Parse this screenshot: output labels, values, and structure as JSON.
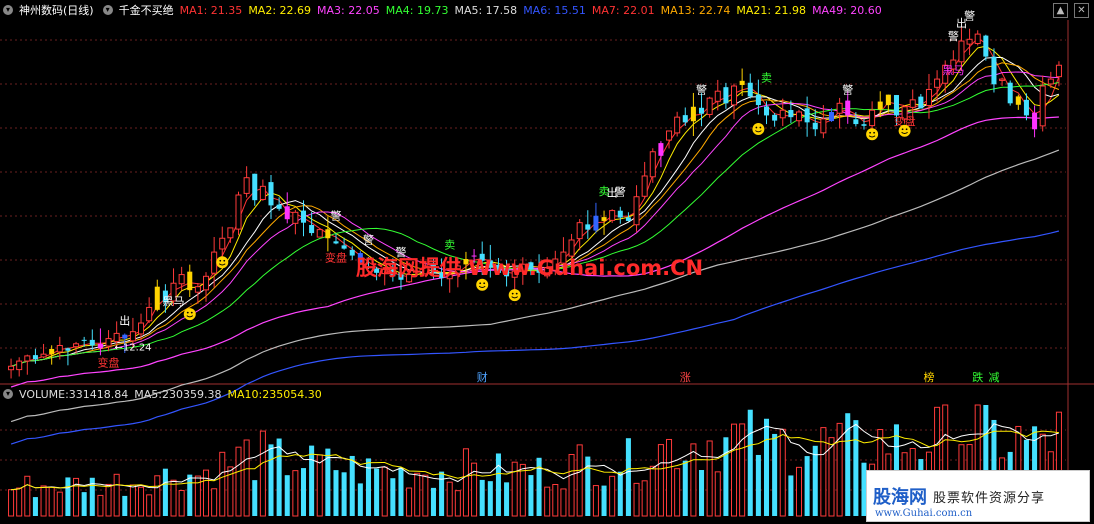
{
  "header": {
    "title": "神州数码(日线)",
    "indicator": "千金不买绝",
    "ma": [
      {
        "label": "MA1:",
        "value": "21.35",
        "color": "#ff3333"
      },
      {
        "label": "MA2:",
        "value": "22.69",
        "color": "#ffee00"
      },
      {
        "label": "MA3:",
        "value": "22.05",
        "color": "#ff44ff"
      },
      {
        "label": "MA4:",
        "value": "19.73",
        "color": "#33ff33"
      },
      {
        "label": "MA5:",
        "value": "17.58",
        "color": "#dddddd"
      },
      {
        "label": "MA6:",
        "value": "15.51",
        "color": "#3355ff"
      },
      {
        "label": "MA7:",
        "value": "22.01",
        "color": "#ff3333"
      },
      {
        "label": "MA13:",
        "value": "22.74",
        "color": "#ffaa00"
      },
      {
        "label": "MA21:",
        "value": "21.98",
        "color": "#ffee00"
      },
      {
        "label": "MA49:",
        "value": "20.60",
        "color": "#ff44ff"
      }
    ]
  },
  "volume_header": {
    "label": "VOLUME:",
    "value": "331418.84",
    "ma5_label": "MA5:",
    "ma5_value": "230359.38",
    "ma10_label": "MA10:",
    "ma10_value": "235054.30"
  },
  "window_buttons": {
    "up": "▲",
    "close": "✕"
  },
  "overlay": "股海网提供 Www.Guhai.com.CN",
  "logo": {
    "brand": "股海网",
    "slogan": "股票软件资源分享",
    "url": "www.Guhai.com.cn"
  },
  "colors": {
    "up": "#ff3a3a",
    "down": "#45e0ff",
    "signal_yellow": "#ffd400",
    "signal_magenta": "#ff33ff",
    "signal_blue": "#3366ff"
  },
  "chart_data": {
    "type": "candlestick",
    "price_range": [
      10.5,
      30.5
    ],
    "closes": [
      10.6,
      10.9,
      11.2,
      11.0,
      11.3,
      11.6,
      11.8,
      11.5,
      11.9,
      12.1,
      11.8,
      11.9,
      12.2,
      12.5,
      12.2,
      12.6,
      13.1,
      14.0,
      15.2,
      14.3,
      15.4,
      15.9,
      15.0,
      15.2,
      15.8,
      17.2,
      18.0,
      18.6,
      20.5,
      21.5,
      20.2,
      21.0,
      19.9,
      19.7,
      19.1,
      19.5,
      18.9,
      18.3,
      18.5,
      18.0,
      17.7,
      17.4,
      17.0,
      16.6,
      16.3,
      16.0,
      16.2,
      15.8,
      15.6,
      15.9,
      16.1,
      16.4,
      16.0,
      15.7,
      15.9,
      16.4,
      16.8,
      17.0,
      16.7,
      16.3,
      16.0,
      15.8,
      16.1,
      16.5,
      16.2,
      16.0,
      16.3,
      16.8,
      17.2,
      17.9,
      18.9,
      18.5,
      19.3,
      19.0,
      19.6,
      19.2,
      19.0,
      20.4,
      21.6,
      23.0,
      23.5,
      24.2,
      25.0,
      24.7,
      25.6,
      25.2,
      26.1,
      26.5,
      25.8,
      26.8,
      27.1,
      26.2,
      25.7,
      25.1,
      24.8,
      25.4,
      25.0,
      25.3,
      24.7,
      24.3,
      24.9,
      25.3,
      25.8,
      25.1,
      24.6,
      24.5,
      25.4,
      25.9,
      26.3,
      25.1,
      25.6,
      26.0,
      25.5,
      26.6,
      27.2,
      28.0,
      28.3,
      29.4,
      29.5,
      29.8,
      28.5,
      26.9,
      27.2,
      25.8,
      26.2,
      25.1,
      24.3,
      26.8,
      27.2,
      28.0
    ],
    "signals": [
      "警",
      "出",
      "卖",
      "黑马",
      "变盘",
      "财",
      "涨",
      "榜",
      "跌",
      "减"
    ],
    "annotations": [
      "12.24"
    ],
    "ma_series": [
      "MA1",
      "MA2",
      "MA3",
      "MA4",
      "MA5",
      "MA6",
      "MA7",
      "MA13",
      "MA21",
      "MA49"
    ],
    "volume": {
      "last": 331418.84,
      "ma5": 230359.38,
      "ma10": 235054.3
    }
  }
}
